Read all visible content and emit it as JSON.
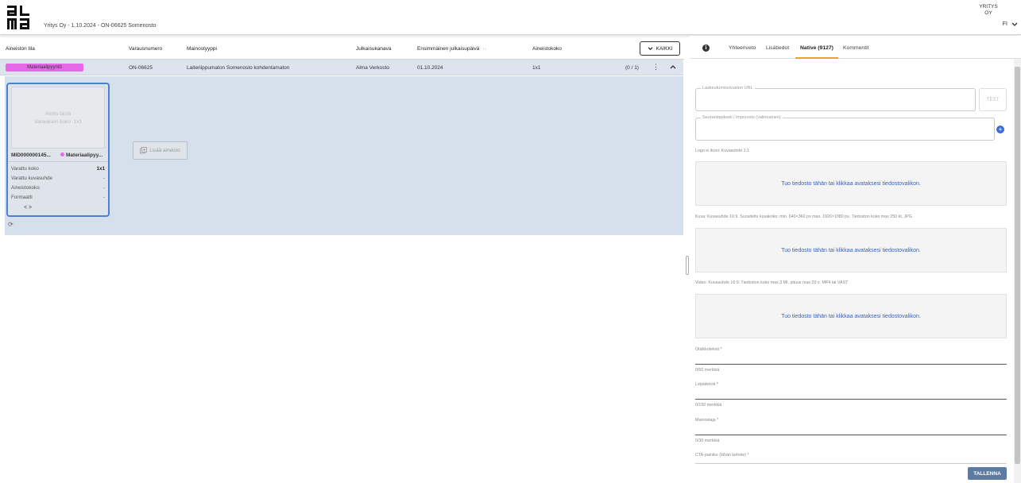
{
  "header": {
    "title": "Yritys Oy - 1.10.2024 - ON-06625 Somenosto",
    "company_line1": "YRITYS",
    "company_line2": "OY",
    "language": "FI"
  },
  "table": {
    "columns": [
      "Aineiston tila",
      "Varausnumero",
      "Mainostyyppi",
      "Julkaisukanava",
      "Ensimmäinen julkaisupäivä",
      "Aineistokoko"
    ],
    "sort_indicator": "↑↓",
    "filter_button": "KAIKKI",
    "row": {
      "status": "Materiaalipyyntö",
      "reservation": "ON-06625",
      "ad_type": "Laiteriippumaton Somenosto kohdentamaton",
      "channel": "Alma Verkosto",
      "first_date": "01.10.2024",
      "size": "1x1",
      "count": "(0 / 1)"
    }
  },
  "card": {
    "drop_line1": "Aloita tästä",
    "drop_line2": "Varauksen koko: 1x1",
    "id": "MID000000145...",
    "tag": "Materiaalipyy...",
    "fields": [
      {
        "label": "Varattu koko",
        "value": "1x1"
      },
      {
        "label": "Varattu kuvasuhde",
        "value": "-"
      },
      {
        "label": "Aineistokoko",
        "value": "-"
      },
      {
        "label": "Formaatti",
        "value": "-"
      }
    ],
    "nav": "< >"
  },
  "add_material_label": "Lisää aineisto",
  "right": {
    "tabs": [
      "Yhteenveto",
      "Lisätiedot",
      "Native (9127)",
      "Kommentit"
    ],
    "active_tab": "Native (9127)",
    "landing_url_label": "Laskeutumissivuston URL",
    "test_label": "TEST",
    "tracking_label": "Seurantapikseli / impressio (valinnainen)",
    "logo_hint": "Logo ei ikoni: Kuvasuhde 1:1",
    "image_hint": "Kuva: Kuvasuhde 16:9. Suositeltu kuvakoko: min. 640×360 px max. 1920×1080 px. Tiedoston koko max 250 kt, JPG",
    "video_hint": "Video: Kuvasuhde 16:9. Tiedoston koko max 3 Mt, pituus max 20 s. MP4 tai VAST",
    "drop_text": "Tuo tiedosto tähän tai klikkaa avataksesi tiedostovalikon.",
    "headline_label": "Otsikkoteksti *",
    "headline_counter": "0/50 merkkiä",
    "body_label": "Leipäteksti *",
    "body_counter": "0/150 merkkiä",
    "advertiser_label": "Mainostaja *",
    "advertiser_counter": "0/30 merkkiä",
    "cta_label": "CTA-painike (lähän kehote) *",
    "save_label": "TALLENNA"
  },
  "colors": {
    "status_pink": "#e668e6",
    "selected_border": "#4a80d6",
    "active_tab_underline": "#f0a030",
    "save_button": "#5d7aa2",
    "link_blue": "#3a62b8"
  }
}
